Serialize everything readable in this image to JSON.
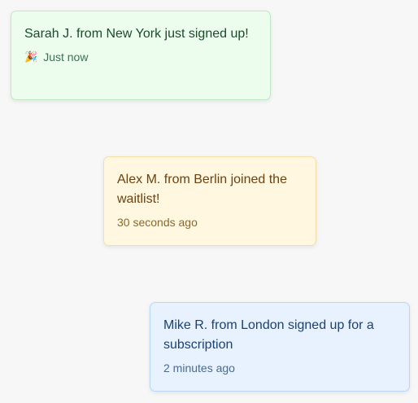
{
  "notifications": [
    {
      "message": "Sarah J. from New York just signed up!",
      "icon": "party-popper-icon",
      "icon_glyph": "🎉",
      "time": "Just now",
      "colors": {
        "background": "#ecfdee",
        "border": "#bfe8c7",
        "text": "#1b4b29"
      }
    },
    {
      "message": "Alex M. from Berlin joined the waitlist!",
      "time": "30 seconds ago",
      "colors": {
        "background": "#fff7df",
        "border": "#f5dfa6",
        "text": "#6b4210"
      }
    },
    {
      "message": "Mike R. from London signed up for a subscription",
      "time": "2 minutes ago",
      "colors": {
        "background": "#e7f2fe",
        "border": "#b9d7f5",
        "text": "#1a4171"
      }
    }
  ]
}
